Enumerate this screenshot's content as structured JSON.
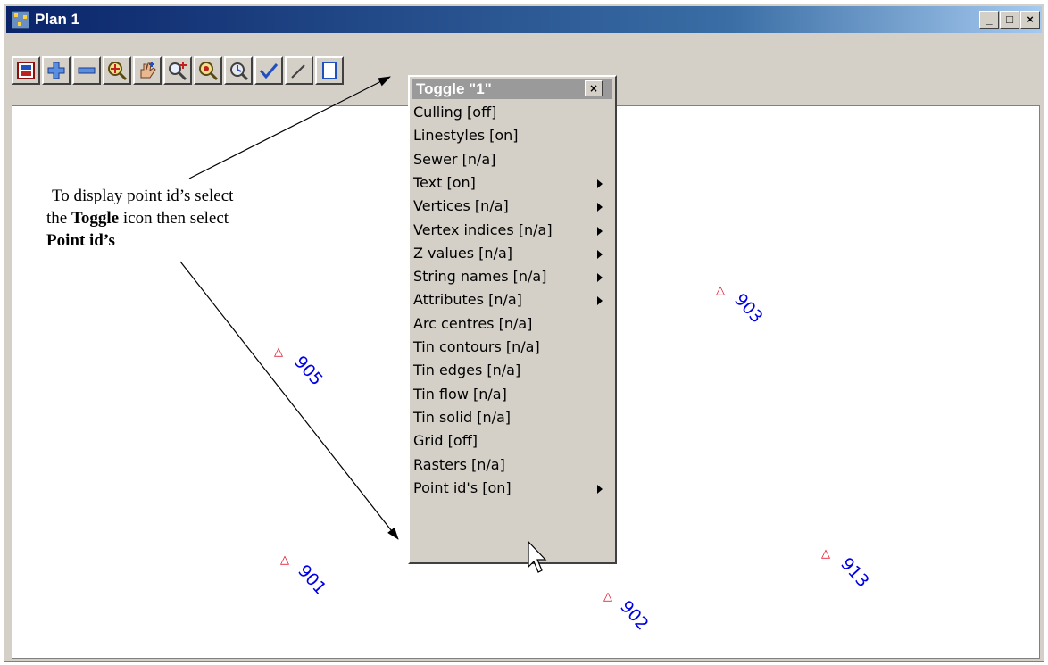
{
  "window": {
    "title": "Plan 1",
    "minimize": "_",
    "maximize": "□",
    "close": "×"
  },
  "toolbar": {
    "tools": [
      {
        "icon": "plot-icon"
      },
      {
        "icon": "zoom-in-icon"
      },
      {
        "icon": "zoom-out-icon"
      },
      {
        "icon": "zoom-fit-icon"
      },
      {
        "icon": "pan-hand-icon"
      },
      {
        "icon": "zoom-window-icon"
      },
      {
        "icon": "zoom-extent-icon"
      },
      {
        "icon": "redraw-icon"
      },
      {
        "icon": "toggle-icon"
      },
      {
        "icon": "pick-icon"
      },
      {
        "icon": "report-icon"
      }
    ]
  },
  "menu": {
    "title": "Toggle \"1\"",
    "close": "×",
    "items": [
      {
        "label": "Culling [off]",
        "submenu": false
      },
      {
        "label": "Linestyles [on]",
        "submenu": false
      },
      {
        "label": "Sewer [n/a]",
        "submenu": false
      },
      {
        "label": "Text [on]",
        "submenu": true
      },
      {
        "label": "Vertices [n/a]",
        "submenu": true
      },
      {
        "label": "Vertex indices [n/a]",
        "submenu": true
      },
      {
        "label": "Z values [n/a]",
        "submenu": true
      },
      {
        "label": "String names [n/a]",
        "submenu": true
      },
      {
        "label": "Attributes [n/a]",
        "submenu": true
      },
      {
        "label": "Arc centres [n/a]",
        "submenu": false
      },
      {
        "label": "Tin contours [n/a]",
        "submenu": false
      },
      {
        "label": "Tin edges [n/a]",
        "submenu": false
      },
      {
        "label": "Tin flow [n/a]",
        "submenu": false
      },
      {
        "label": "Tin solid [n/a]",
        "submenu": false
      },
      {
        "label": "Grid [off]",
        "submenu": false
      },
      {
        "label": "Rasters [n/a]",
        "submenu": false
      },
      {
        "label": "Point id's [on]",
        "submenu": true
      }
    ]
  },
  "points": [
    {
      "id": "905"
    },
    {
      "id": "903"
    },
    {
      "id": "901"
    },
    {
      "id": "902"
    },
    {
      "id": "913"
    }
  ],
  "point_marker": "△",
  "annotation": {
    "line1": "To display point id’s select",
    "line2_pre": "the ",
    "line2_bold": "Toggle",
    "line2_post": " icon then select",
    "line3_bold": "Point id’s"
  },
  "colors": {
    "point_marker": "#e0001a",
    "point_label": "#0000e6",
    "titlebar": "#0a246a",
    "menu_title": "#9a9a9a"
  }
}
